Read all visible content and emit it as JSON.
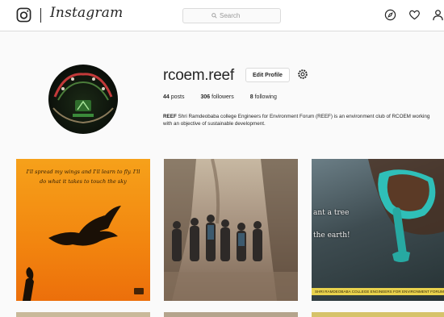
{
  "header": {
    "brand": "Instagram",
    "search_placeholder": "Search",
    "nav_icons": [
      "compass-icon",
      "heart-icon",
      "profile-icon"
    ]
  },
  "profile": {
    "username": "rcoem.reef",
    "edit_button": "Edit Profile",
    "stats": {
      "posts_count": "44",
      "posts_label": "posts",
      "followers_count": "306",
      "followers_label": "followers",
      "following_count": "8",
      "following_label": "following"
    },
    "bio_name": "REEF",
    "bio_text": "Shri Ramdeobaba college Engineers for Environment Forum (REEF) is an environment club of RCOEM working with an objective of sustainable development."
  },
  "posts": [
    {
      "quote": "I'll spread my wings and I'll learn to fly. I'll do what it takes to touch the sky"
    },
    {},
    {
      "overlay_line1": "ant a tree",
      "overlay_line2": "the earth!",
      "strip_text": "SHRI RAMDEOBABA COLLEGE ENGINEERS FOR ENVIRONMENT FORUM"
    }
  ],
  "colors": {
    "accent_orange": "#f2850f",
    "border": "#dbdbdb",
    "background": "#fafafa"
  }
}
